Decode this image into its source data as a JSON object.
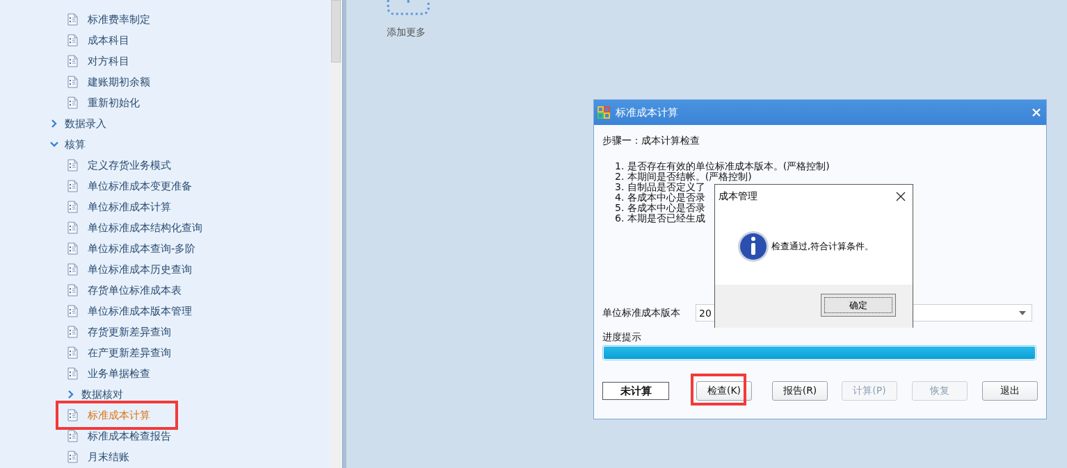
{
  "sidebar": {
    "tree": [
      {
        "kind": "leaf",
        "label": "标准费率制定",
        "selected": false
      },
      {
        "kind": "leaf",
        "label": "成本科目",
        "selected": false
      },
      {
        "kind": "leaf",
        "label": "对方科目",
        "selected": false
      },
      {
        "kind": "leaf",
        "label": "建账期初余额",
        "selected": false
      },
      {
        "kind": "leaf",
        "label": "重新初始化",
        "selected": false
      },
      {
        "kind": "group",
        "label": "数据录入",
        "expanded": false
      },
      {
        "kind": "group",
        "label": "核算",
        "expanded": true,
        "children": [
          {
            "kind": "leaf",
            "label": "定义存货业务模式",
            "selected": false
          },
          {
            "kind": "leaf",
            "label": "单位标准成本变更准备",
            "selected": false
          },
          {
            "kind": "leaf",
            "label": "单位标准成本计算",
            "selected": false
          },
          {
            "kind": "leaf",
            "label": "单位标准成本结构化查询",
            "selected": false
          },
          {
            "kind": "leaf",
            "label": "单位标准成本查询-多阶",
            "selected": false
          },
          {
            "kind": "leaf",
            "label": "单位标准成本历史查询",
            "selected": false
          },
          {
            "kind": "leaf",
            "label": "存货单位标准成本表",
            "selected": false
          },
          {
            "kind": "leaf",
            "label": "单位标准成本版本管理",
            "selected": false
          },
          {
            "kind": "leaf",
            "label": "存货更新差异查询",
            "selected": false
          },
          {
            "kind": "leaf",
            "label": "在产更新差异查询",
            "selected": false
          },
          {
            "kind": "leaf",
            "label": "业务单据检查",
            "selected": false
          },
          {
            "kind": "group",
            "label": "数据核对",
            "expanded": false
          },
          {
            "kind": "leaf",
            "label": "标准成本计算",
            "selected": true,
            "highlighted": true
          },
          {
            "kind": "leaf",
            "label": "标准成本检查报告",
            "selected": false
          },
          {
            "kind": "leaf",
            "label": "月末结账",
            "selected": false
          }
        ]
      }
    ]
  },
  "workspace": {
    "add_tile": {
      "label": "添加更多"
    }
  },
  "dialog": {
    "title": "标准成本计算",
    "step": "步骤一：成本计算检查",
    "checks": [
      "1. 是否存在有效的单位标准成本版本。(严格控制)",
      "2. 本期间是否结帐。(严格控制)",
      "3. 自制品是否定义了",
      "4. 各成本中心是否录",
      "5. 各成本中心是否录",
      "6. 本期是否已经生成"
    ],
    "version": {
      "label": "单位标准成本版本",
      "value": "20"
    },
    "progress": {
      "label": "进度提示",
      "level": 1
    },
    "status": "未计算",
    "buttons": [
      {
        "label": "检查(K)",
        "disabled": false,
        "highlighted": true
      },
      {
        "label": "报告(R)",
        "disabled": false,
        "highlighted": false
      },
      {
        "label": "计算(P)",
        "disabled": true,
        "highlighted": false
      },
      {
        "label": "恢复",
        "disabled": true,
        "highlighted": false
      },
      {
        "label": "退出",
        "disabled": false,
        "highlighted": false
      }
    ]
  },
  "message_box": {
    "title": "成本管理",
    "message": "检查通过,符合计算条件。",
    "button": "确定"
  }
}
